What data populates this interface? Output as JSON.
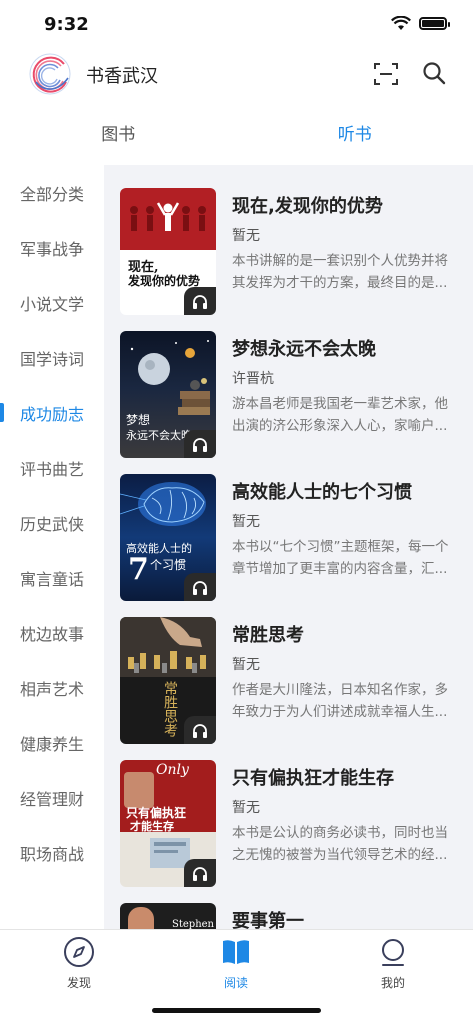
{
  "status_bar": {
    "time": "9:32"
  },
  "header": {
    "title": "书香武汉"
  },
  "top_tabs": [
    {
      "label": "图书",
      "active": false
    },
    {
      "label": "听书",
      "active": true
    }
  ],
  "sidebar": {
    "items": [
      {
        "label": "全部分类",
        "active": false
      },
      {
        "label": "军事战争",
        "active": false
      },
      {
        "label": "小说文学",
        "active": false
      },
      {
        "label": "国学诗词",
        "active": false
      },
      {
        "label": "成功励志",
        "active": true
      },
      {
        "label": "评书曲艺",
        "active": false
      },
      {
        "label": "历史武侠",
        "active": false
      },
      {
        "label": "寓言童话",
        "active": false
      },
      {
        "label": "枕边故事",
        "active": false
      },
      {
        "label": "相声艺术",
        "active": false
      },
      {
        "label": "健康养生",
        "active": false
      },
      {
        "label": "经管理财",
        "active": false
      },
      {
        "label": "职场商战",
        "active": false
      }
    ]
  },
  "books": [
    {
      "title": "现在,发现你的优势",
      "author": "暂无",
      "desc": "本书讲解的是一套识别个人优势并将其发挥为才干的方案，最终目的是...",
      "cover_text_1": "现在,",
      "cover_text_2": "发现你的优势"
    },
    {
      "title": "梦想永远不会太晚",
      "author": "许晋杭",
      "desc": "游本昌老师是我国老一辈艺术家，他出演的济公形象深入人心，家喻户...",
      "cover_text_1": "梦想",
      "cover_text_2": "永远不会太晚"
    },
    {
      "title": "高效能人士的七个习惯",
      "author": "暂无",
      "desc": "本书以“七个习惯”主题框架，每一个章节增加了更丰富的内容含量，汇...",
      "cover_text_1": "高效能人士的",
      "cover_text_2": "7",
      "cover_text_3": "个习惯"
    },
    {
      "title": "常胜思考",
      "author": "暂无",
      "desc": "作者是大川隆法，日本知名作家，多年致力于为人们讲述成就幸福人生...",
      "cover_text_1": "常胜思考"
    },
    {
      "title": "只有偏执狂才能生存",
      "author": "暂无",
      "desc": "本书是公认的商务必读书，同时也当之无愧的被誉为当代领导艺术的经...",
      "cover_text_1": "Only",
      "cover_text_2": "只有偏执狂",
      "cover_text_3": "才能生存"
    },
    {
      "title": "要事第一",
      "author": "",
      "desc": "",
      "cover_text_1": "Stephen"
    }
  ],
  "bottom_nav": [
    {
      "label": "发现",
      "icon": "compass-icon",
      "active": false
    },
    {
      "label": "阅读",
      "icon": "book-icon",
      "active": true
    },
    {
      "label": "我的",
      "icon": "user-icon",
      "active": false
    }
  ],
  "colors": {
    "accent": "#1e88e5",
    "main_bg": "#f2f3f7"
  }
}
